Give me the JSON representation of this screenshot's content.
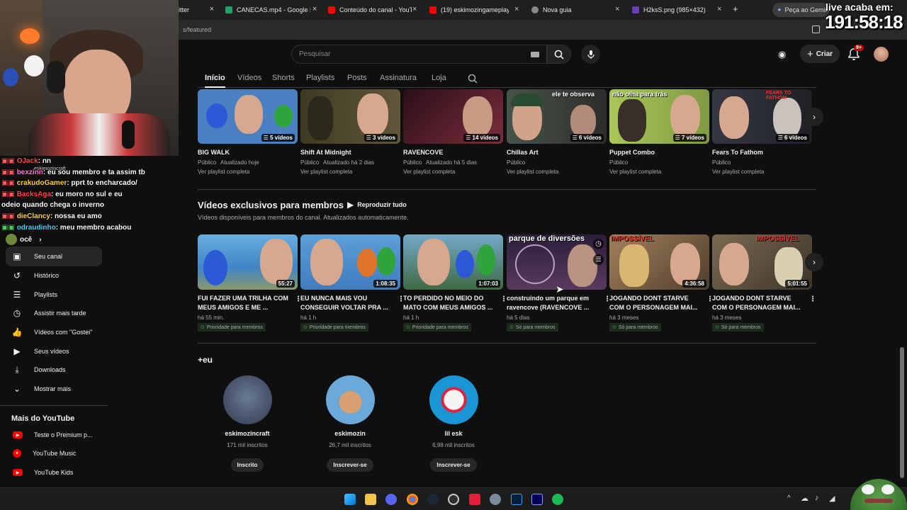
{
  "browser": {
    "tabs": [
      {
        "label": "itter",
        "color": "#1d9bf0"
      },
      {
        "label": "CANECAS.mp4 - Google D",
        "color": "#1fa463"
      },
      {
        "label": "Conteúdo do canal - YouTu",
        "color": "#ff0000"
      },
      {
        "label": "(19) eskimozingameplaysH",
        "color": "#ff0000"
      },
      {
        "label": "Nova guia",
        "color": "#888888"
      },
      {
        "label": "H2ksS.png (985×432)",
        "color": "#6a3fb5"
      }
    ],
    "gemini_label": "Peça ao Gemini",
    "url": "s/featured"
  },
  "stream": {
    "live_label": "live acaba em:",
    "timer": "191:58:18"
  },
  "chat": [
    {
      "user": "OJack",
      "msg": ": nn",
      "color": "#ff4a4a"
    },
    {
      "user": "bexzinn",
      "msg": ": eu sou membro e ta assim tb",
      "color": "#ff7ad9"
    },
    {
      "user": "crakudoGamer",
      "msg": ": pprt to encharcado/",
      "color": "#ffd23f"
    },
    {
      "user": "BacksAga",
      "msg": ": eu moro no sul e eu",
      "color": "#ff4a4a"
    },
    {
      "user": "",
      "msg": "odeio quando chega o inverno",
      "color": "#ffffff"
    },
    {
      "user": "dieClancy",
      "msg": ": nossa eu amo",
      "color": "#ffd23f"
    },
    {
      "user": "odraudinho",
      "msg": ": meu membro acabou",
      "color": "#4ad0ff"
    }
  ],
  "chat_overlay_name": "eskimozincraft",
  "sidebar": {
    "you_label": "ocê",
    "items": [
      {
        "label": "Seu canal",
        "icon": "channel-icon",
        "glyph": "▣"
      },
      {
        "label": "Histórico",
        "icon": "history-icon",
        "glyph": "↺"
      },
      {
        "label": "Playlists",
        "icon": "playlists-icon",
        "glyph": "☰"
      },
      {
        "label": "Assistir mais tarde",
        "icon": "watch-later-icon",
        "glyph": "◷"
      },
      {
        "label": "Vídeos com \"Gostei\"",
        "icon": "like-icon",
        "glyph": "👍"
      },
      {
        "label": "Seus vídeos",
        "icon": "your-videos-icon",
        "glyph": "▶"
      },
      {
        "label": "Downloads",
        "icon": "download-icon",
        "glyph": "⤓"
      },
      {
        "label": "Mostrar mais",
        "icon": "chevron-down-icon",
        "glyph": "⌄"
      }
    ],
    "more_title": "Mais do YouTube",
    "more_items": [
      {
        "label": "Teste o Premium p...",
        "icon": "yt-premium-icon"
      },
      {
        "label": "YouTube Music",
        "icon": "yt-music-icon"
      },
      {
        "label": "YouTube Kids",
        "icon": "yt-kids-icon"
      }
    ]
  },
  "header": {
    "search_placeholder": "Pesquisar",
    "create_label": "Criar",
    "notif_count": "9+"
  },
  "nav_tabs": [
    "Início",
    "Vídeos",
    "Shorts",
    "Playlists",
    "Posts",
    "Assinatura",
    "Loja"
  ],
  "playlists": [
    {
      "title": "BIG WALK",
      "count": "5 vídeos",
      "status": "Público",
      "updated": "Atualizado hoje",
      "link": "Ver playlist completa",
      "bg": "#4a7fc1"
    },
    {
      "title": "Shift At Midnight",
      "count": "3 vídeos",
      "status": "Público",
      "updated": "Atualizado há 2 dias",
      "link": "Ver playlist completa",
      "bg": "#4f4a2a"
    },
    {
      "title": "RAVENCOVE",
      "count": "14 vídeos",
      "status": "Público",
      "updated": "Atualizado há 5 dias",
      "link": "Ver playlist completa",
      "bg": "#5a2a36"
    },
    {
      "title": "Chillas Art",
      "count": "6 vídeos",
      "status": "Público",
      "updated": "",
      "link": "Ver playlist completa",
      "bg": "#3a4a3f"
    },
    {
      "title": "Puppet Combo",
      "count": "7 vídeos",
      "status": "Público",
      "updated": "",
      "link": "Ver playlist completa",
      "bg": "#9dbd52"
    },
    {
      "title": "Fears To Fathom",
      "count": "6 vídeos",
      "status": "Público",
      "updated": "",
      "link": "Ver playlist completa",
      "bg": "#2d2f36"
    }
  ],
  "playlist_overlays": {
    "chillas": "ele te observa",
    "puppet": "não olha para trás",
    "fears": "FEARS TO FATHOM"
  },
  "members_section": {
    "title": "Vídeos exclusivos para membros",
    "play_all": "Reproduzir tudo",
    "subtitle": "Vídeos disponíveis para membros do canal. Atualizados automaticamente."
  },
  "member_videos": [
    {
      "title1": "FUI FAZER UMA TRILHA COM",
      "title2": "MEUS AMIGOS E ME ...",
      "duration": "55:27",
      "age": "há 55 min.",
      "badge": "Prioridade para membros",
      "bg": "#3f84c6"
    },
    {
      "title1": "EU NUNCA MAIS VOU",
      "title2": "CONSEGUIR VOLTAR PRA ...",
      "duration": "1:08:35",
      "age": "há 1 h",
      "badge": "Prioridade para membros",
      "bg": "#4a86c8"
    },
    {
      "title1": "TO PERDIDO NO MEIO DO",
      "title2": "MATO COM MEUS AMIGOS ...",
      "duration": "1:07:03",
      "age": "há 1 h",
      "badge": "Prioridade para membros",
      "bg": "#3e6a43"
    },
    {
      "title1": "construindo um parque em",
      "title2": "ravencove (RAVENCOVE ...",
      "duration": "",
      "age": "há 5 dias",
      "badge": "Só para membros",
      "bg": "#3a2a48"
    },
    {
      "title1": "JOGANDO DONT STARVE",
      "title2": "COM O PERSONAGEM MAI...",
      "duration": "4:36:58",
      "age": "há 3 meses",
      "badge": "Só para membros",
      "bg": "#6d5a3e"
    },
    {
      "title1": "JOGANDO DONT STARVE",
      "title2": "COM O PERSONAGEM MAI...",
      "duration": "5:01:55",
      "age": "há 3 meses",
      "badge": "Só para membros",
      "bg": "#5e5040"
    }
  ],
  "member_overlays": {
    "park": "parque de diversões",
    "impossivel": "IMPOSSÍVEL"
  },
  "eu_section": {
    "title": "+eu",
    "channels": [
      {
        "name": "eskimozincraft",
        "subs": "171 mil inscritos",
        "button": "Inscrito",
        "bg": "#3f4e66"
      },
      {
        "name": "eskimozin",
        "subs": "26,7 mil inscritos",
        "button": "Inscrever-se",
        "bg": "#6aa9d8"
      },
      {
        "name": "lil esk",
        "subs": "6,98 mil inscritos",
        "button": "Inscrever-se",
        "bg": "#1a96d6"
      }
    ]
  }
}
